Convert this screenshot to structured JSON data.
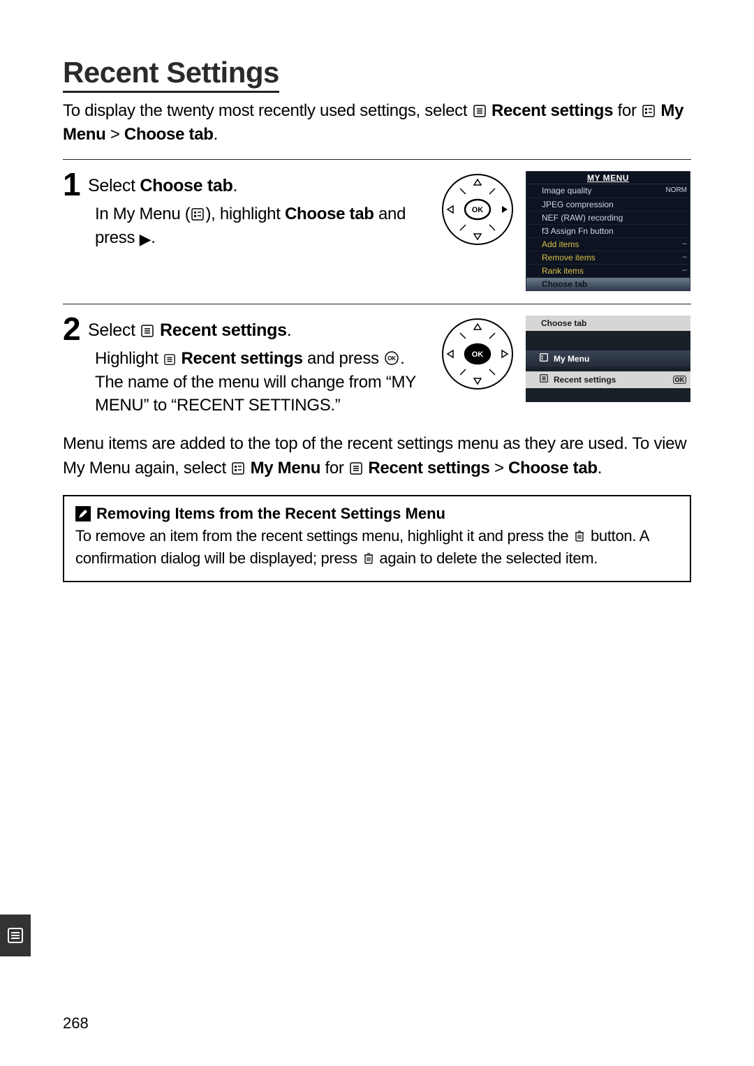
{
  "title": "Recent Settings",
  "intro": {
    "pre": "To display the twenty most recently used settings, select ",
    "bold1": "Recent settings",
    "mid": " for ",
    "bold2": "My Menu",
    "gt": " > ",
    "bold3": "Choose tab",
    "post": "."
  },
  "step1": {
    "num": "1",
    "head_pre": "Select ",
    "head_bold": "Choose tab",
    "head_post": ".",
    "body_pre": "In My Menu (",
    "body_mid": "), highlight ",
    "body_bold": "Choose tab",
    "body_mid2": " and press ",
    "body_post": "."
  },
  "lcd1": {
    "header": "MY MENU",
    "rows": [
      {
        "label": "Image quality",
        "val": "NORM"
      },
      {
        "label": "JPEG compression",
        "val": ""
      },
      {
        "label": "NEF (RAW) recording",
        "val": ""
      },
      {
        "label": "f3 Assign Fn button",
        "val": ""
      },
      {
        "label": "Add items",
        "val": "--",
        "yellow": true
      },
      {
        "label": "Remove items",
        "val": "--",
        "yellow": true
      },
      {
        "label": "Rank items",
        "val": "--",
        "yellow": true
      },
      {
        "label": "Choose tab",
        "val": "",
        "hl": true
      }
    ]
  },
  "step2": {
    "num": "2",
    "head_pre": "Select ",
    "head_bold": "Recent settings",
    "head_post": ".",
    "body_pre": "Highlight ",
    "body_bold": "Recent settings",
    "body_mid": " and press ",
    "body_mid2": ". The name of the menu will change from “MY MENU” to “RECENT SETTINGS.”"
  },
  "lcd2": {
    "top": "Choose tab",
    "opt1": "My Menu",
    "opt2": "Recent settings",
    "ok": "OK"
  },
  "aftertext": {
    "line1": "Menu items are added to the top of the recent settings menu as they are used.  To view My Menu again, select ",
    "bold1": "My Menu",
    "mid": " for ",
    "bold2": "Recent settings",
    "gt": " > ",
    "bold3": "Choose tab",
    "post": "."
  },
  "note": {
    "title": "Removing Items from the Recent Settings Menu",
    "body_pre": "To remove an item from the recent settings menu, highlight it and press the ",
    "body_mid": " button.  A confirmation dialog will be displayed; press ",
    "body_post": " again to delete the selected item."
  },
  "page_number": "268"
}
